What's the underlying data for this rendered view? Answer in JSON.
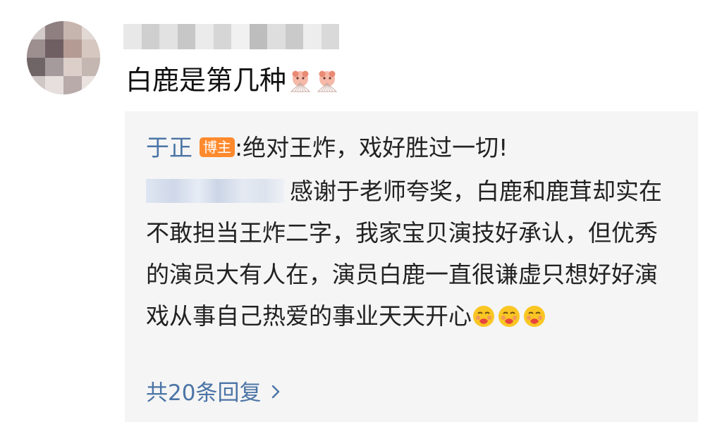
{
  "comment": {
    "text": "白鹿是第几种"
  },
  "reply_thread": {
    "first_reply": {
      "author": "于正",
      "badge": "博主",
      "separator": ":",
      "text": "绝对王炸，戏好胜过一切!"
    },
    "second_reply": {
      "text": "感谢于老师夸奖，白鹿和鹿茸却实在不敢担当王炸二字，我家宝贝演技好承认，但优秀的演员大有人在，演员白鹿一直很谦虚只想好好演戏从事自己热爱的事业天天开心"
    },
    "more_replies_label": "共20条回复"
  },
  "colors": {
    "link_blue": "#4b74a6",
    "badge_orange": "#ff8a2e",
    "reply_background": "#f5f5f5",
    "text": "#111111"
  },
  "icons": {
    "comment_emojis": [
      "fan-face-emoji-icon",
      "fan-face-emoji-icon"
    ],
    "reply_emojis": [
      "kiss-face-emoji-icon",
      "kiss-face-emoji-icon",
      "kiss-face-emoji-icon"
    ],
    "more_icon": "chevron-right-icon"
  }
}
